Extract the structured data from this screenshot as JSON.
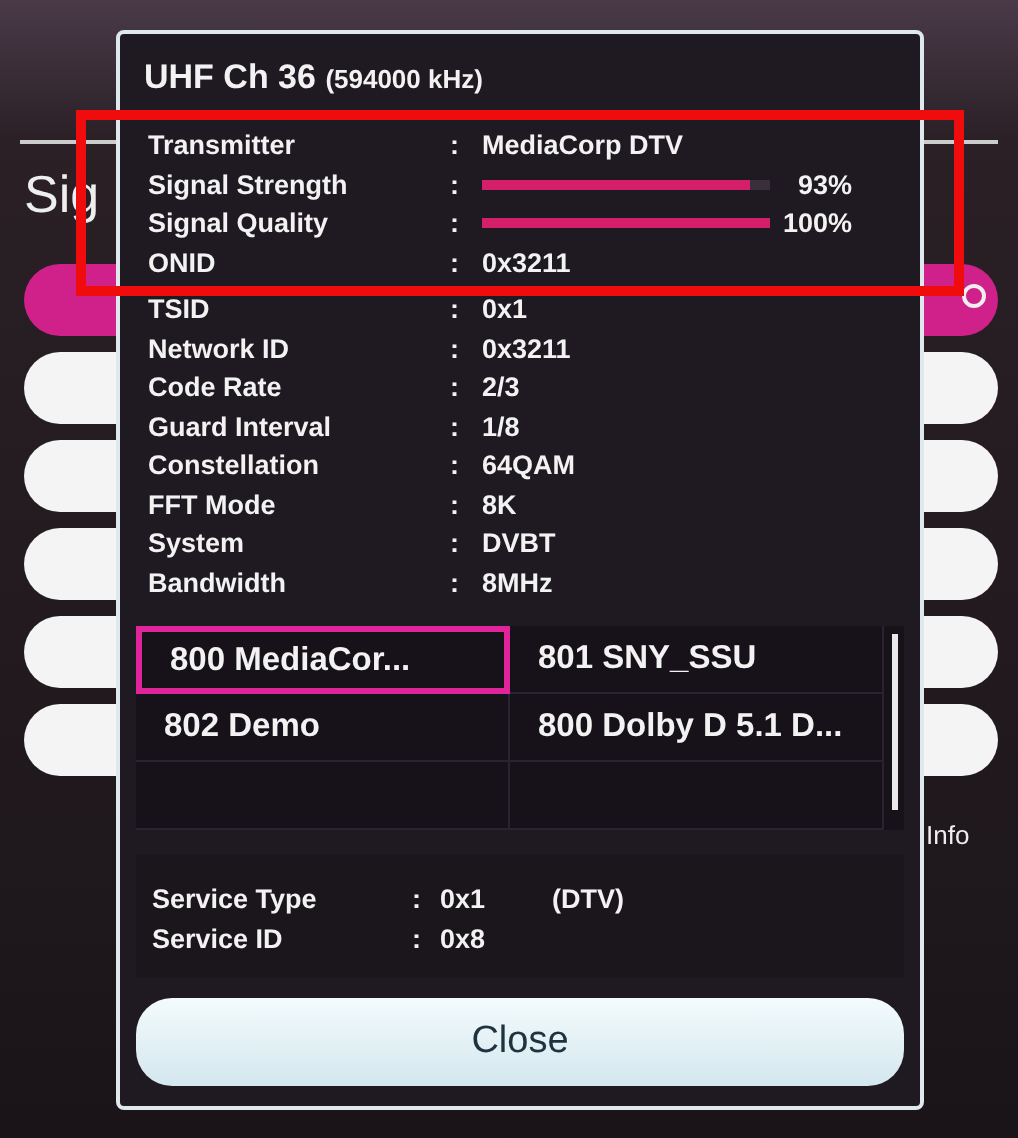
{
  "background": {
    "heading": "Sig",
    "info": "Info",
    "side_buttons": [
      {
        "selected": true
      },
      {
        "selected": false
      },
      {
        "selected": false
      },
      {
        "selected": false
      },
      {
        "selected": false
      },
      {
        "selected": false
      }
    ]
  },
  "dialog": {
    "title": "UHF Ch 36",
    "frequency": "(594000 kHz)",
    "details": [
      {
        "kind": "text",
        "label": "Transmitter",
        "separator": ":",
        "value": "MediaCorp DTV",
        "highlighted": true
      },
      {
        "kind": "meter",
        "label": "Signal Strength",
        "separator": ":",
        "level": 0.93,
        "reading": "93%",
        "highlighted": true
      },
      {
        "kind": "meter",
        "label": "Signal Quality",
        "separator": ":",
        "level": 1,
        "reading": "100%",
        "highlighted": true
      },
      {
        "kind": "text",
        "label": "ONID",
        "separator": ":",
        "value": "0x3211",
        "highlighted": true
      },
      {
        "kind": "text",
        "label": "TSID",
        "separator": ":",
        "value": "0x1",
        "highlighted": false
      },
      {
        "kind": "text",
        "label": "Network ID",
        "separator": ":",
        "value": "0x3211",
        "highlighted": false
      },
      {
        "kind": "text",
        "label": "Code Rate",
        "separator": ":",
        "value": "2/3",
        "highlighted": false
      },
      {
        "kind": "text",
        "label": "Guard Interval",
        "separator": ":",
        "value": "1/8",
        "highlighted": false
      },
      {
        "kind": "text",
        "label": "Constellation",
        "separator": ":",
        "value": "64QAM",
        "highlighted": false
      },
      {
        "kind": "text",
        "label": "FFT Mode",
        "separator": ":",
        "value": "8K",
        "highlighted": false
      },
      {
        "kind": "text",
        "label": "System",
        "separator": ":",
        "value": "DVBT",
        "highlighted": false
      },
      {
        "kind": "text",
        "label": "Bandwidth",
        "separator": ":",
        "value": "8MHz",
        "highlighted": false
      }
    ],
    "channels": [
      {
        "name": "800 MediaCor...",
        "selected": true
      },
      {
        "name": "801 SNY_SSU",
        "selected": false
      },
      {
        "name": "802 Demo",
        "selected": false
      },
      {
        "name": "800 Dolby D 5.1 D...",
        "selected": false
      }
    ],
    "service": [
      {
        "label": "Service Type",
        "separator": ":",
        "value": "0x1",
        "note": "(DTV)"
      },
      {
        "label": "Service ID",
        "separator": ":",
        "value": "0x8"
      }
    ],
    "close_button": "Close"
  }
}
